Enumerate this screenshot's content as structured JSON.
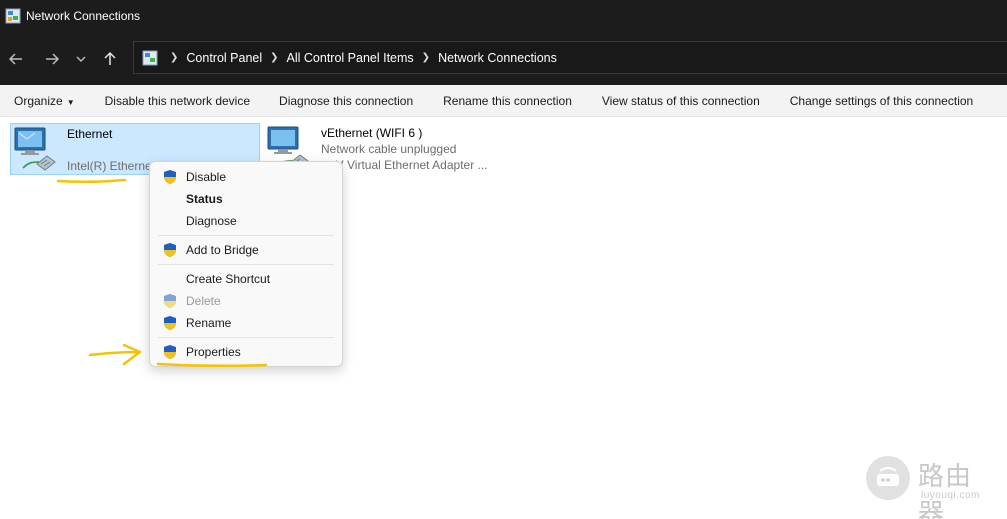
{
  "window": {
    "title": "Network Connections"
  },
  "nav": {
    "back_icon": "arrow-left-icon",
    "forward_icon": "arrow-right-icon",
    "recent_icon": "chevron-down-icon",
    "up_icon": "arrow-up-icon"
  },
  "breadcrumb": {
    "items": [
      "Control Panel",
      "All Control Panel Items",
      "Network Connections"
    ]
  },
  "commands": {
    "organize": "Organize",
    "disable": "Disable this network device",
    "diagnose": "Diagnose this connection",
    "rename": "Rename this connection",
    "view_status": "View status of this connection",
    "change_settings": "Change settings of this connection"
  },
  "adapters": [
    {
      "name": "Ethernet",
      "status": "",
      "device": "Intel(R) Etherne"
    },
    {
      "name": "vEthernet (WIFI 6 )",
      "status": "Network cable unplugged",
      "device": "er-V Virtual Ethernet Adapter ..."
    }
  ],
  "context_menu": {
    "items": [
      {
        "label": "Disable",
        "shield": true
      },
      {
        "label": "Status",
        "bold": true
      },
      {
        "label": "Diagnose"
      },
      {
        "label": "Add to Bridge",
        "shield": true
      },
      {
        "label": "Create Shortcut"
      },
      {
        "label": "Delete",
        "shield": true,
        "disabled": true
      },
      {
        "label": "Rename",
        "shield": true
      },
      {
        "label": "Properties",
        "shield": true
      }
    ]
  },
  "watermark": {
    "brand": "路由器",
    "url": "luyouqi.com"
  },
  "colors": {
    "titlebar_bg": "#1c1c1c",
    "selection_bg": "#cce8ff",
    "selection_border": "#99d1ff",
    "annotation": "#f5c400",
    "shield_blue": "#1f5fbf",
    "shield_yellow": "#f3c21a"
  }
}
